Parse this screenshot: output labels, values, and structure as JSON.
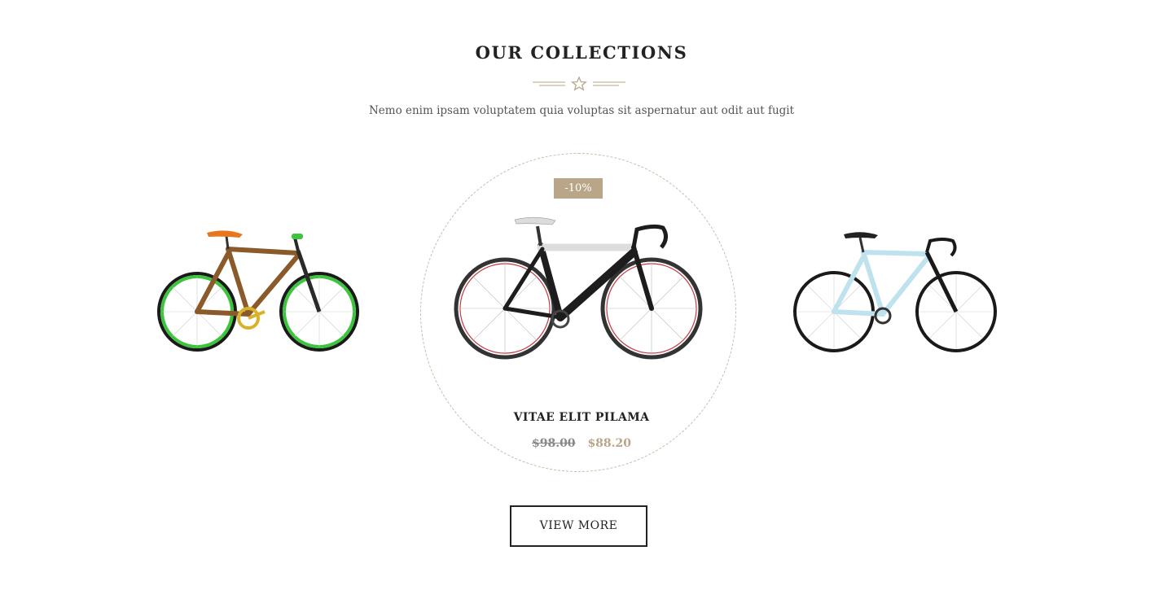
{
  "section": {
    "title": "OUR COLLECTIONS",
    "subtitle": "Nemo enim ipsam voluptatem quia voluptas sit aspernatur aut odit aut fugit",
    "ornament_icon": "star-icon"
  },
  "products": [
    {
      "image": "bamboo-fixie-bike-image",
      "frame_color": "#8b5a2b",
      "wheel_color": "#3cc43c"
    },
    {
      "image": "trek-road-bike-image",
      "badge": "-10%",
      "name": "VITAE ELIT PILAMA",
      "price_old": "$98.00",
      "price_new": "$88.20"
    },
    {
      "image": "light-blue-road-bike-image",
      "frame_color": "#bfe3ee",
      "wheel_color": "#1a1a1a"
    }
  ],
  "view_more_label": "VIEW MORE",
  "colors": {
    "accent": "#b9a688",
    "text": "#222222",
    "muted": "#555555"
  }
}
